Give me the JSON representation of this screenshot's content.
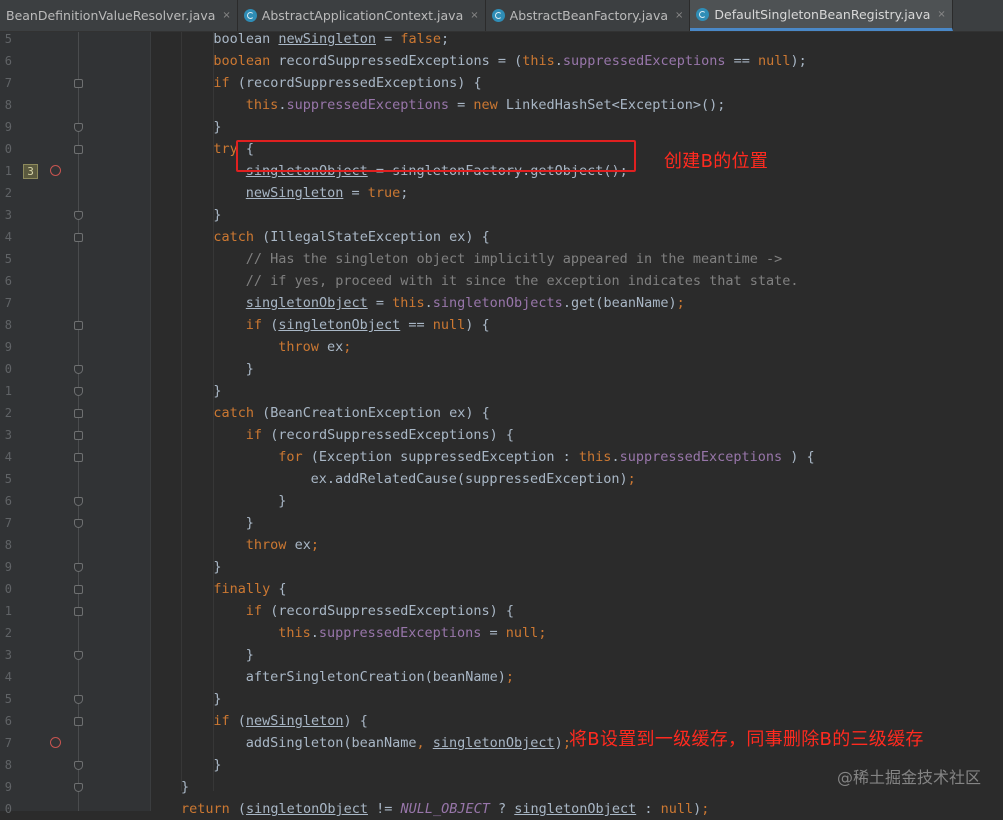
{
  "tabs": [
    {
      "label": "BeanDefinitionValueResolver.java",
      "active": false
    },
    {
      "label": "AbstractApplicationContext.java",
      "active": false
    },
    {
      "label": "AbstractBeanFactory.java",
      "active": false
    },
    {
      "label": "DefaultSingletonBeanRegistry.java",
      "active": true
    }
  ],
  "tab_close": "×",
  "gutter": {
    "line_numbers": [
      "5",
      "6",
      "7",
      "8",
      "9",
      "0",
      "1",
      "2",
      "3",
      "4",
      "5",
      "6",
      "7",
      "8",
      "9",
      "0",
      "1",
      "2",
      "3",
      "4",
      "5",
      "6",
      "7",
      "8",
      "9",
      "0",
      "1",
      "2",
      "3",
      "4",
      "5",
      "6",
      "7",
      "8",
      "9",
      "0",
      "1"
    ],
    "bookmark_label": "3"
  },
  "code_lines": [
    [
      [
        "",
        "boolean "
      ],
      [
        "u",
        "newSingleton"
      ],
      [
        "",
        " = "
      ],
      [
        "k",
        "false"
      ],
      [
        "",
        ";"
      ]
    ],
    [
      [
        "k",
        "boolean "
      ],
      [
        "",
        "recordSuppressedExceptions = ("
      ],
      [
        "k",
        "this"
      ],
      [
        "",
        "."
      ],
      [
        "f",
        "suppressedExceptions"
      ],
      [
        "",
        " == "
      ],
      [
        "k",
        "null"
      ],
      [
        "",
        ");"
      ]
    ],
    [
      [
        "k",
        "if "
      ],
      [
        "",
        "(recordSuppressedExceptions) {"
      ]
    ],
    [
      [
        "k",
        "this"
      ],
      [
        "",
        "."
      ],
      [
        "f",
        "suppressedExceptions"
      ],
      [
        "",
        " = "
      ],
      [
        "k",
        "new "
      ],
      [
        "",
        "LinkedHashSet<Exception>();"
      ]
    ],
    [
      [
        "",
        "}"
      ]
    ],
    [
      [
        "k",
        "try "
      ],
      [
        "",
        "{"
      ]
    ],
    [
      [
        "u",
        "singletonObject"
      ],
      [
        "",
        " = singletonFactory.getObject();"
      ]
    ],
    [
      [
        "u",
        "newSingleton"
      ],
      [
        "",
        " = "
      ],
      [
        "k",
        "true"
      ],
      [
        "",
        ";"
      ]
    ],
    [
      [
        "",
        "}"
      ]
    ],
    [
      [
        "k",
        "catch "
      ],
      [
        "",
        "(IllegalStateException ex) {"
      ]
    ],
    [
      [
        "c",
        "// Has the singleton object implicitly appeared in the meantime ->"
      ]
    ],
    [
      [
        "c",
        "// if yes, proceed with it since the exception indicates that state."
      ]
    ],
    [
      [
        "u",
        "singletonObject"
      ],
      [
        "",
        " = "
      ],
      [
        "k",
        "this"
      ],
      [
        "",
        "."
      ],
      [
        "f",
        "singletonObjects"
      ],
      [
        "",
        ".get(beanName)"
      ],
      [
        "k",
        ";"
      ]
    ],
    [
      [
        "k",
        "if "
      ],
      [
        "",
        "("
      ],
      [
        "u",
        "singletonObject"
      ],
      [
        "",
        " == "
      ],
      [
        "k",
        "null"
      ],
      [
        "",
        ") {"
      ]
    ],
    [
      [
        "k",
        "throw "
      ],
      [
        "",
        "ex"
      ],
      [
        "k",
        ";"
      ]
    ],
    [
      [
        "",
        "}"
      ]
    ],
    [
      [
        "",
        "}"
      ]
    ],
    [
      [
        "k",
        "catch "
      ],
      [
        "",
        "(BeanCreationException ex) {"
      ]
    ],
    [
      [
        "k",
        "if "
      ],
      [
        "",
        "(recordSuppressedExceptions) {"
      ]
    ],
    [
      [
        "k",
        "for "
      ],
      [
        "",
        "(Exception suppressedException : "
      ],
      [
        "k",
        "this"
      ],
      [
        "",
        "."
      ],
      [
        "f",
        "suppressedExceptions"
      ],
      [
        "",
        " ) {"
      ]
    ],
    [
      [
        "",
        "ex.addRelatedCause(suppressedException)"
      ],
      [
        "k",
        ";"
      ]
    ],
    [
      [
        "",
        "}"
      ]
    ],
    [
      [
        "",
        "}"
      ]
    ],
    [
      [
        "k",
        "throw "
      ],
      [
        "",
        "ex"
      ],
      [
        "k",
        ";"
      ]
    ],
    [
      [
        "",
        "}"
      ]
    ],
    [
      [
        "k",
        "finally "
      ],
      [
        "",
        "{"
      ]
    ],
    [
      [
        "k",
        "if "
      ],
      [
        "",
        "(recordSuppressedExceptions) {"
      ]
    ],
    [
      [
        "k",
        "this"
      ],
      [
        "",
        "."
      ],
      [
        "f",
        "suppressedExceptions"
      ],
      [
        "",
        " = "
      ],
      [
        "k",
        "null"
      ],
      [
        "k",
        ";"
      ]
    ],
    [
      [
        "",
        "}"
      ]
    ],
    [
      [
        "",
        "afterSingletonCreation(beanName)"
      ],
      [
        "k",
        ";"
      ]
    ],
    [
      [
        "",
        "}"
      ]
    ],
    [
      [
        "k",
        "if "
      ],
      [
        "",
        "("
      ],
      [
        "u",
        "newSingleton"
      ],
      [
        "",
        ") {"
      ]
    ],
    [
      [
        "",
        "addSingleton(beanName"
      ],
      [
        "k",
        ", "
      ],
      [
        "u",
        "singletonObject"
      ],
      [
        "",
        ")"
      ],
      [
        "k",
        ";"
      ]
    ],
    [
      [
        "",
        "}"
      ]
    ],
    [
      [
        "",
        "}"
      ]
    ],
    [
      [
        "k",
        "return "
      ],
      [
        "",
        "("
      ],
      [
        "u",
        "singletonObject"
      ],
      [
        "",
        " != "
      ],
      [
        "it",
        "NULL_OBJECT"
      ],
      [
        "",
        " ? "
      ],
      [
        "u",
        "singletonObject"
      ],
      [
        "",
        " : "
      ],
      [
        "k",
        "null"
      ],
      [
        "",
        ")"
      ],
      [
        "k",
        ";"
      ]
    ]
  ],
  "annotations": {
    "create_b": "创建B的位置",
    "add_singleton": "将B设置到一级缓存，同事删除B的三级缓存"
  },
  "watermark": "@稀土掘金技术社区",
  "colors": {
    "editor_bg": "#2b2b2b",
    "gutter_bg": "#313335",
    "keyword": "#cc7832",
    "field": "#9876aa",
    "comment": "#808080",
    "text": "#a9b7c6",
    "annotation_red": "#ff2a1f"
  }
}
